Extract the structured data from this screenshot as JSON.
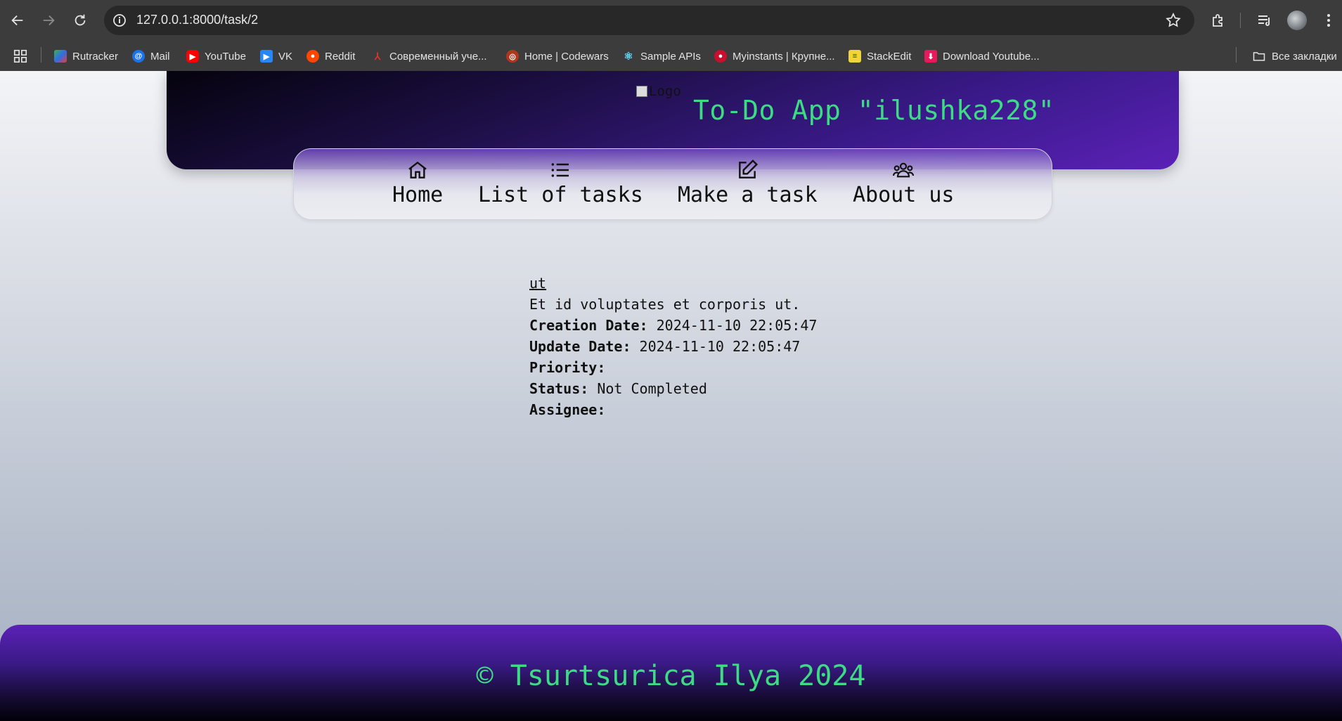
{
  "browser": {
    "url": "127.0.0.1:8000/task/2",
    "bookmarks": [
      {
        "label": "Rutracker",
        "icon": "rutracker-icon"
      },
      {
        "label": "Mail",
        "icon": "mail-icon"
      },
      {
        "label": "YouTube",
        "icon": "youtube-icon"
      },
      {
        "label": "VK",
        "icon": "vk-icon"
      },
      {
        "label": "Reddit",
        "icon": "reddit-icon"
      },
      {
        "label": "Современный уче...",
        "icon": "javascript-info-icon"
      },
      {
        "label": "Home | Codewars",
        "icon": "codewars-icon"
      },
      {
        "label": "Sample APIs",
        "icon": "react-icon"
      },
      {
        "label": "Myinstants | Крупне...",
        "icon": "myinstants-icon"
      },
      {
        "label": "StackEdit",
        "icon": "stackedit-icon"
      },
      {
        "label": "Download Youtube...",
        "icon": "download-icon"
      }
    ],
    "all_bookmarks": "Все закладки"
  },
  "header": {
    "logo_alt": "Logo",
    "title": "To-Do App \"ilushka228\""
  },
  "nav": [
    {
      "label": "Home",
      "icon": "home-icon"
    },
    {
      "label": "List of tasks",
      "icon": "list-icon"
    },
    {
      "label": "Make a task",
      "icon": "edit-icon"
    },
    {
      "label": "About us",
      "icon": "users-icon"
    }
  ],
  "task": {
    "title": "ut",
    "description": "Et id voluptates et corporis ut.",
    "creation_label": "Creation Date:",
    "creation_value": "2024-11-10 22:05:47",
    "update_label": "Update Date:",
    "update_value": "2024-11-10 22:05:47",
    "priority_label": "Priority:",
    "priority_value": "",
    "status_label": "Status:",
    "status_value": "Not Completed",
    "assignee_label": "Assignee:",
    "assignee_value": ""
  },
  "footer": {
    "text": "© Tsurtsurica Ilya 2024"
  },
  "colors": {
    "accent": "#3ddc84",
    "header_purple": "#5b21b6"
  }
}
